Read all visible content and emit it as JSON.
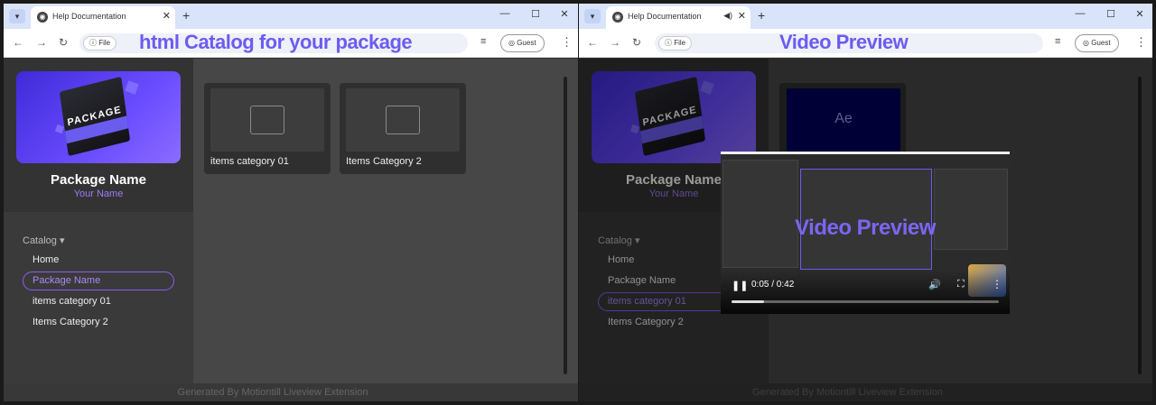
{
  "left": {
    "tab_title": "Help Documentation",
    "overlay_title": "html Catalog for your package",
    "site_chip": "File",
    "guest": "Guest",
    "package_name": "Package Name",
    "author": "Your Name",
    "box_label": "PACKAGE",
    "catalog_label": "Catalog",
    "nav": [
      "Home",
      "Package Name",
      "items category 01",
      "Items Category 2"
    ],
    "active_nav": "Package Name",
    "folders": [
      "items category 01",
      "Items Category 2"
    ],
    "footer": "Generated By Motiontill Liveview Extension"
  },
  "right": {
    "tab_title": "Help Documentation",
    "overlay_title": "Video Preview",
    "site_chip": "File",
    "guest": "Guest",
    "package_name": "Package Name",
    "author": "Your Name",
    "box_label": "PACKAGE",
    "catalog_label": "Catalog",
    "nav": [
      "Home",
      "Package Name",
      "items category 01",
      "Items Category 2"
    ],
    "active_nav": "items category 01",
    "ae_label": "Ae",
    "video_title": "Video Preview",
    "video_time": "0:05 / 0:42",
    "video_progress": 0.12,
    "footer": "Generated By Motiontill Liveview Extension"
  },
  "icons": {
    "tab_list": "chevron-down-icon",
    "favicon": "globe-icon",
    "close": "close-icon",
    "new_tab": "plus-icon",
    "back": "arrow-left-icon",
    "forward": "arrow-right-icon",
    "reload": "reload-icon",
    "info": "info-icon",
    "reading_list": "reading-list-icon",
    "profile": "profile-icon",
    "menu": "kebab-menu-icon",
    "folder": "folder-icon",
    "audio": "speaker-icon",
    "pause": "pause-icon",
    "volume": "volume-icon",
    "fullscreen": "fullscreen-icon"
  },
  "colors": {
    "accent": "#6b5cf0",
    "active_border": "#8e5cf5",
    "author": "#9d7cf5",
    "tabbar": "#d9e3fa"
  }
}
